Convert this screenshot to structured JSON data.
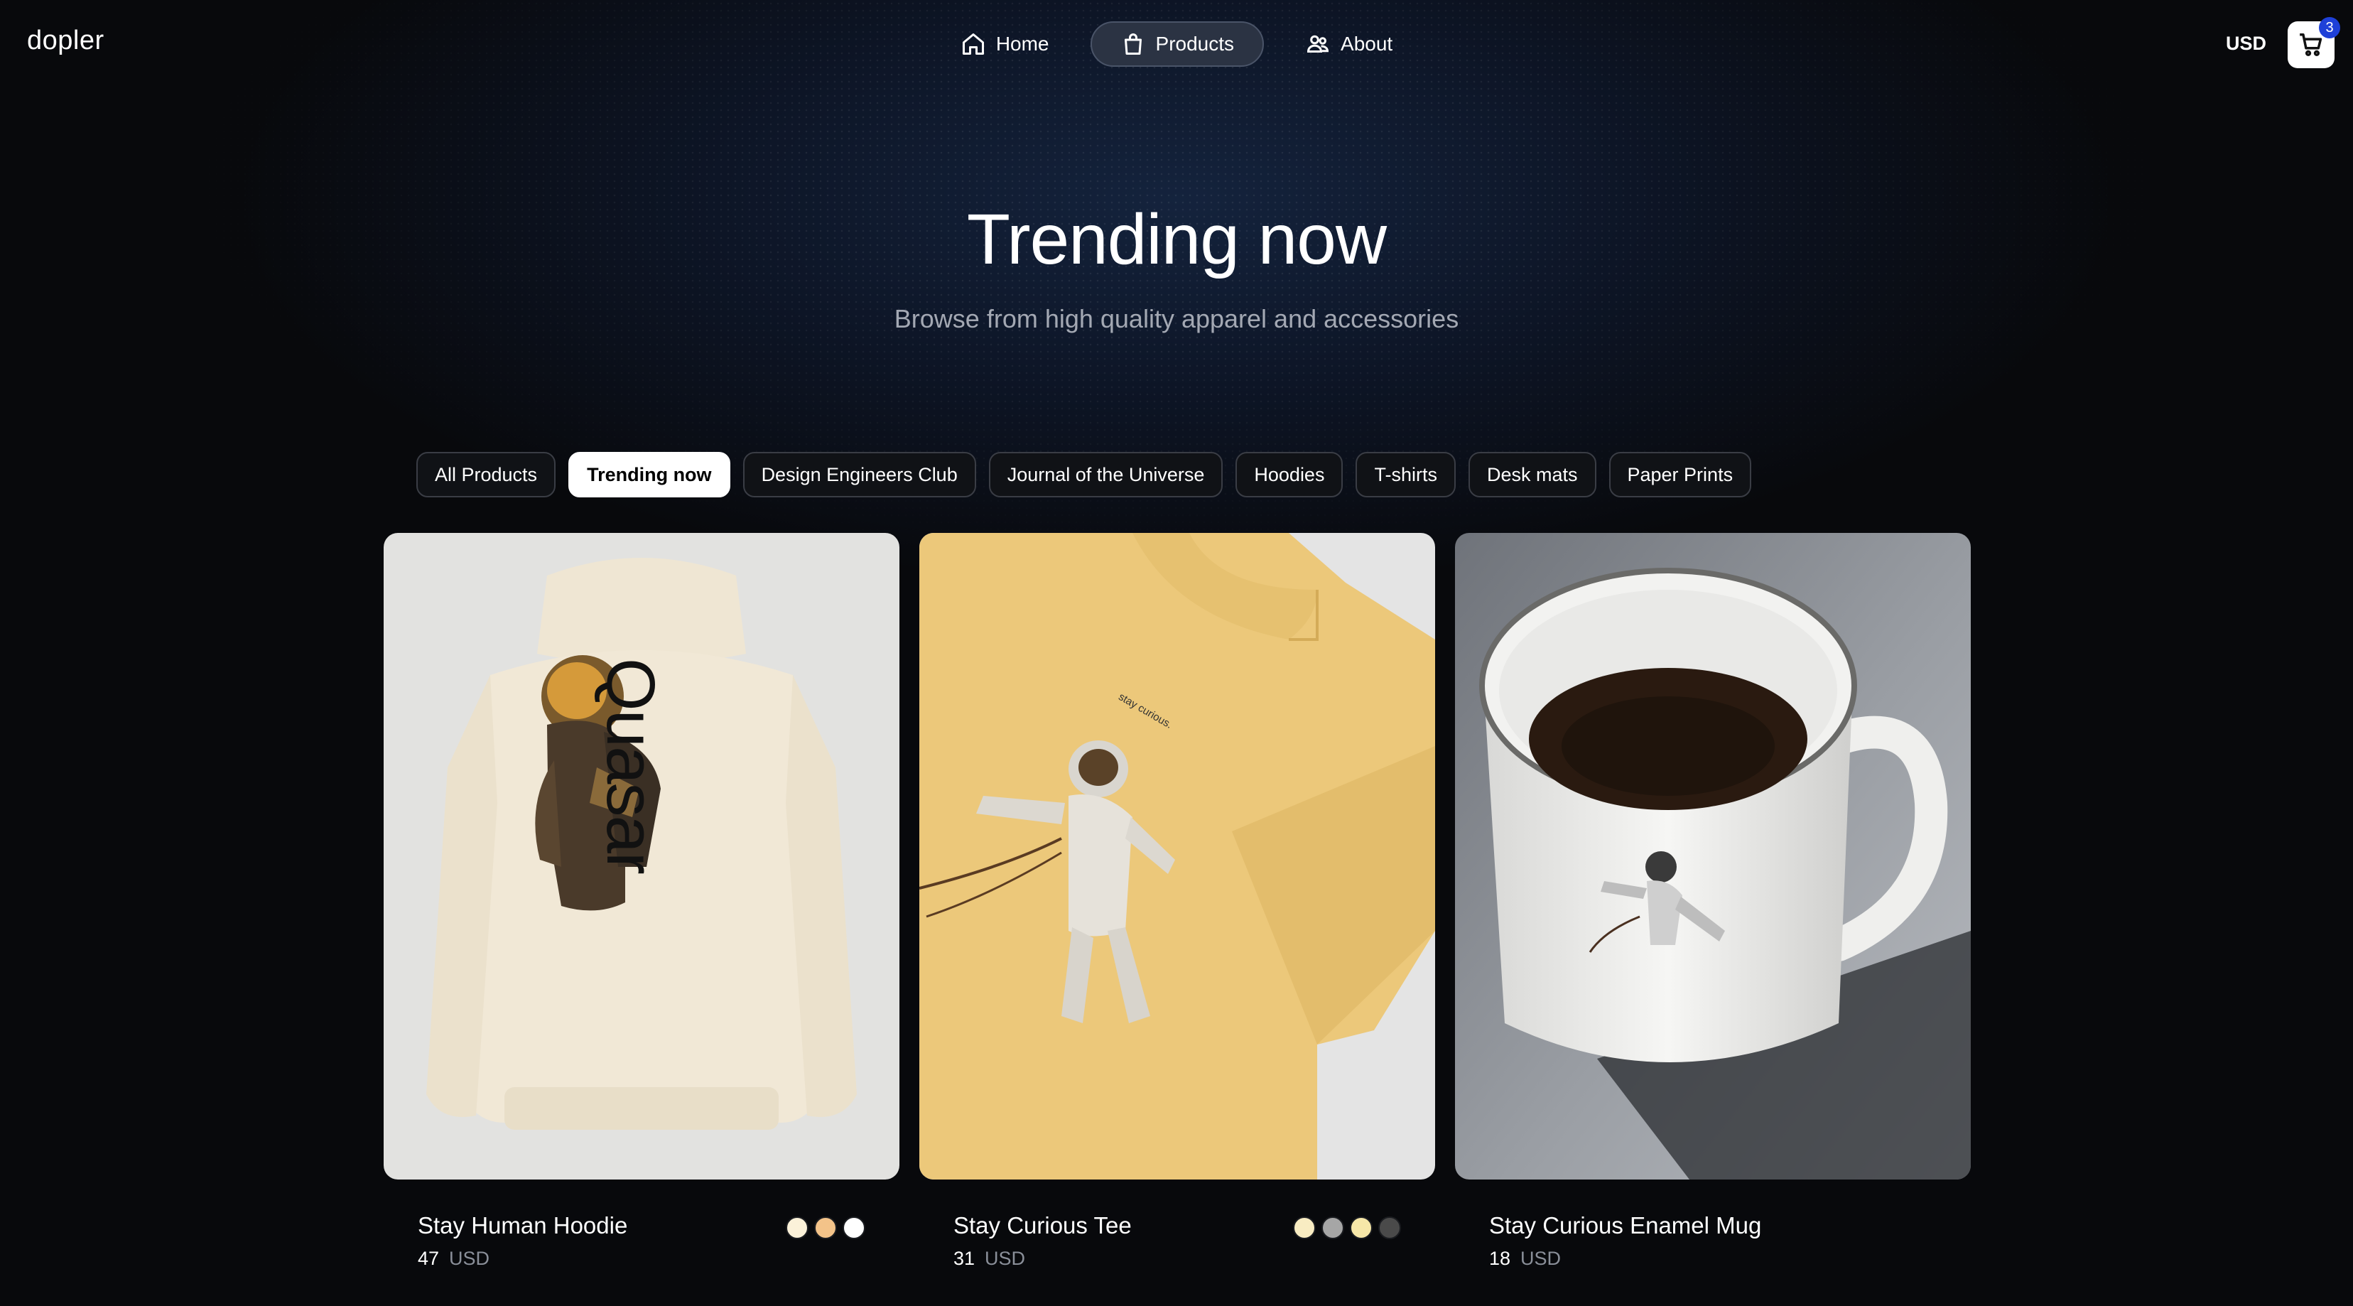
{
  "header": {
    "logo": "dopler",
    "nav": [
      {
        "label": "Home",
        "icon": "home-icon"
      },
      {
        "label": "Products",
        "icon": "shopping-bag-icon",
        "active": true
      },
      {
        "label": "About",
        "icon": "users-icon"
      }
    ],
    "currency": "USD",
    "cart_count": "3"
  },
  "hero": {
    "title": "Trending now",
    "subtitle": "Browse from high quality apparel and accessories"
  },
  "filters": [
    {
      "label": "All Products",
      "active": false
    },
    {
      "label": "Trending now",
      "active": true
    },
    {
      "label": "Design Engineers Club",
      "active": false
    },
    {
      "label": "Journal of the Universe",
      "active": false
    },
    {
      "label": "Hoodies",
      "active": false
    },
    {
      "label": "T-shirts",
      "active": false
    },
    {
      "label": "Desk mats",
      "active": false
    },
    {
      "label": "Paper Prints",
      "active": false
    }
  ],
  "products": [
    {
      "name": "Stay Human Hoodie",
      "price": "47",
      "currency": "USD",
      "print_text": "Quasar",
      "colors": [
        "#fbf1d9",
        "#f3c389",
        "#ffffff"
      ]
    },
    {
      "name": "Stay Curious Tee",
      "price": "31",
      "currency": "USD",
      "print_text": "stay curious.",
      "colors": [
        "#f8ecc2",
        "#a6a6a6",
        "#f6e7a8",
        "#4a4a4a"
      ]
    },
    {
      "name": "Stay Curious Enamel Mug",
      "price": "18",
      "currency": "USD",
      "colors": []
    }
  ],
  "colors": {
    "accent_badge": "#1e40d8",
    "hoodie_bg": "#e2e2e2",
    "hoodie_fabric": "#f1e8d6",
    "tee_fabric": "#ecc87a"
  }
}
